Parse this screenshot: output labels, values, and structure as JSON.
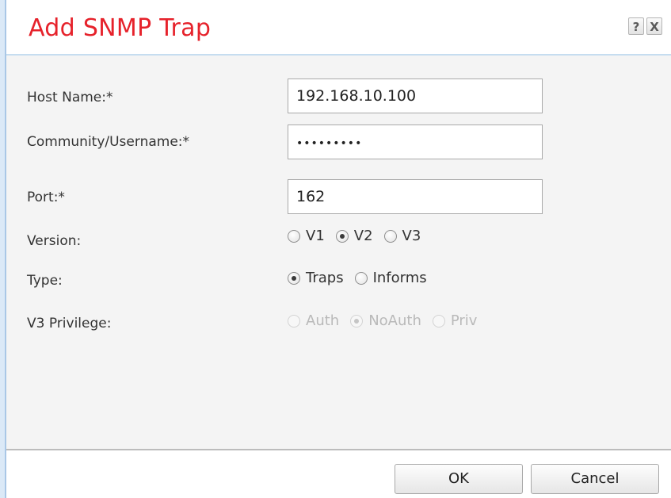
{
  "dialog": {
    "title": "Add SNMP Trap",
    "help_label": "?",
    "close_label": "X"
  },
  "form": {
    "host_name": {
      "label": "Host Name:*",
      "value": "192.168.10.100"
    },
    "community": {
      "label": "Community/Username:*",
      "value": "•••••••••"
    },
    "port": {
      "label": "Port:*",
      "value": "162"
    },
    "version": {
      "label": "Version:",
      "options": [
        "V1",
        "V2",
        "V3"
      ],
      "selected": "V2"
    },
    "type": {
      "label": "Type:",
      "options": [
        "Traps",
        "Informs"
      ],
      "selected": "Traps"
    },
    "v3_privilege": {
      "label": "V3 Privilege:",
      "options": [
        "Auth",
        "NoAuth",
        "Priv"
      ],
      "selected": "NoAuth",
      "disabled": true
    }
  },
  "footer": {
    "ok_label": "OK",
    "cancel_label": "Cancel"
  },
  "colors": {
    "title": "#e6222b",
    "body_bg": "#f4f4f4",
    "disabled_text": "#b9b9b9"
  }
}
